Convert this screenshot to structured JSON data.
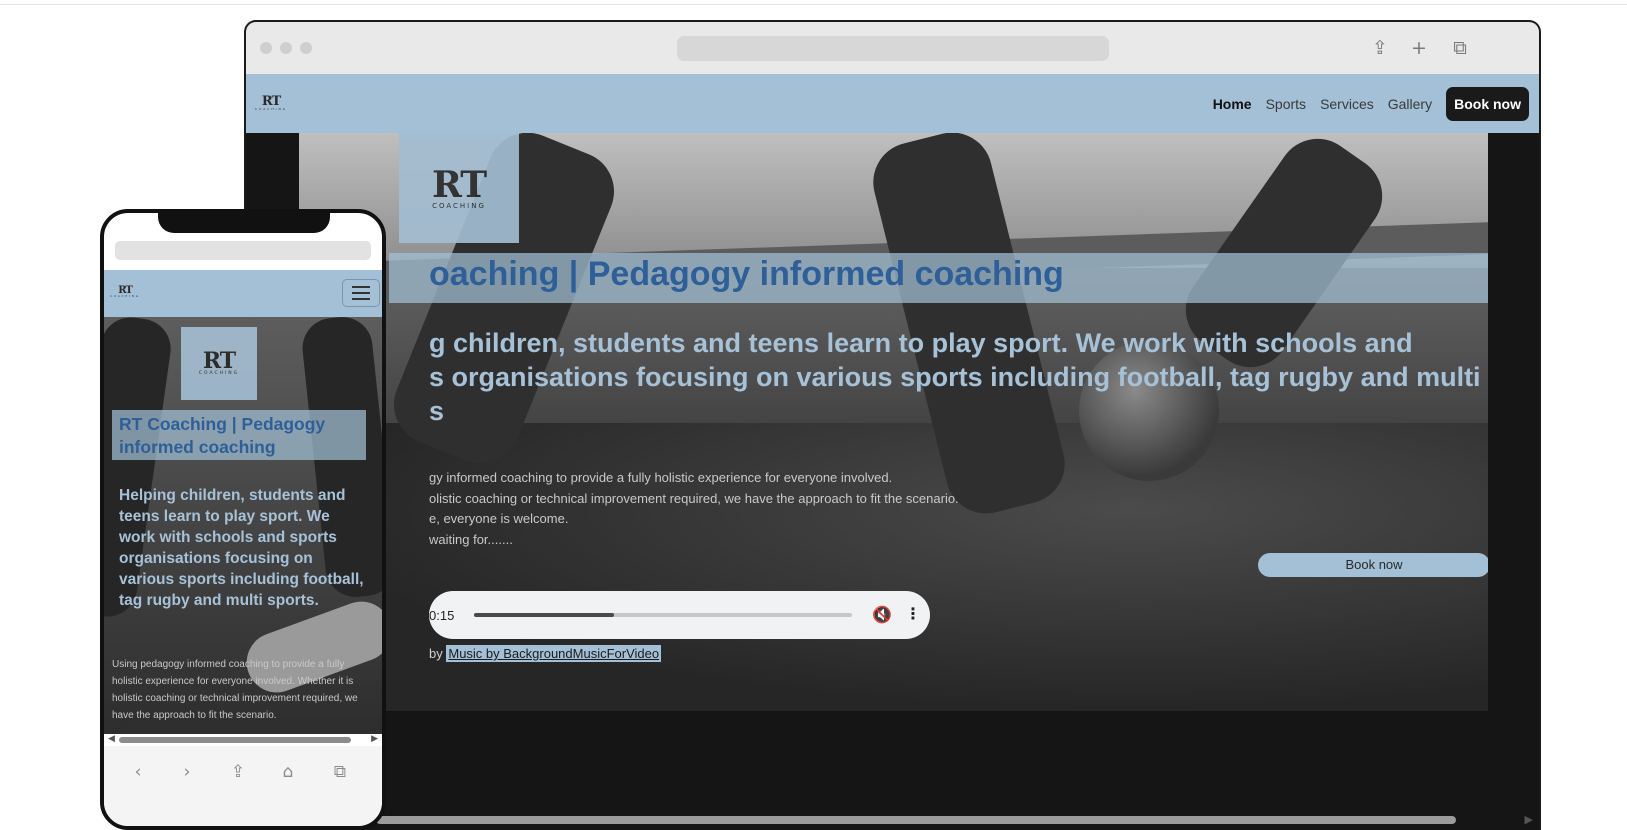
{
  "desktop": {
    "brand": {
      "initials": "RT",
      "subtitle": "COACHING"
    },
    "nav": {
      "items": [
        "Home",
        "Sports",
        "Services",
        "Gallery"
      ],
      "active": "Home",
      "cta": "Book now"
    },
    "toolbar_icons": [
      "share-icon",
      "new-tab-icon",
      "tabs-icon"
    ],
    "hero": {
      "title": "oaching | Pedagogy informed coaching",
      "intro_line1": "g children, students and teens learn to play sport. We work with schools and",
      "intro_line2": "s organisations focusing on various sports including football, tag rugby and multi",
      "intro_line3": "s",
      "para_lines": [
        "gy informed coaching to provide a fully holistic experience for everyone involved.",
        "olistic coaching or technical improvement required, we have the approach to fit the scenario.",
        "e, everyone is welcome.",
        "waiting for......."
      ],
      "book_button": "Book now",
      "audio": {
        "time": "0:15",
        "progress": 0.37,
        "muted": true
      },
      "credit_prefix": "by",
      "credit_link": "Music by BackgroundMusicForVideo"
    }
  },
  "phone": {
    "brand": {
      "initials": "RT",
      "subtitle": "COACHING"
    },
    "hero": {
      "title": "RT Coaching | Pedagogy informed coaching",
      "intro": "Helping children, students and teens learn to play sport. We work with schools and sports organisations focusing on various sports including football, tag rugby and multi sports.",
      "para": "Using pedagogy informed coaching to provide a fully holistic experience for everyone involved. Whether it is holistic coaching or technical improvement required, we have the approach to fit the scenario."
    },
    "toolbar_icons": [
      "back-icon",
      "forward-icon",
      "share-icon",
      "bookmarks-icon",
      "tabs-icon"
    ]
  },
  "colors": {
    "accent": "#a3c0d6",
    "title_blue": "#2f5f98",
    "dark_button": "#1a1a1a"
  }
}
